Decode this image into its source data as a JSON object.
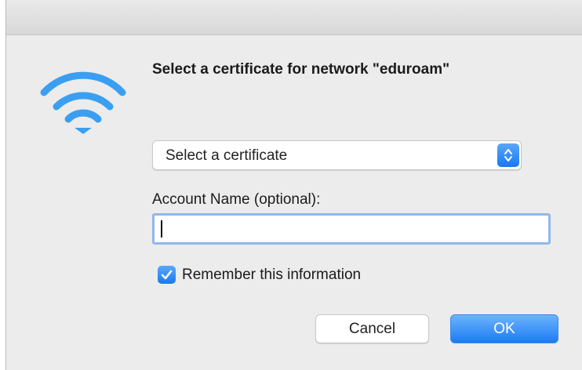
{
  "dialog": {
    "title": "Select a certificate for network \"eduroam\"",
    "icon": "wifi-icon"
  },
  "certificate_select": {
    "selected_value": "Select a certificate"
  },
  "account": {
    "label": "Account Name (optional):",
    "value": ""
  },
  "remember": {
    "label": "Remember this information",
    "checked": true
  },
  "buttons": {
    "cancel_label": "Cancel",
    "ok_label": "OK"
  },
  "colors": {
    "accent": "#1a78f2",
    "wifi_blue": "#3a9ff2",
    "window_bg": "#ececec"
  }
}
